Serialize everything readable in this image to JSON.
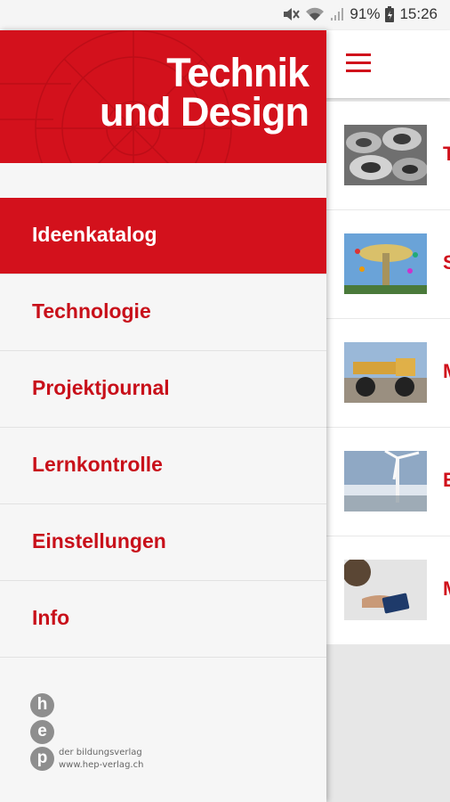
{
  "status": {
    "battery": "91%",
    "time": "15:26"
  },
  "drawer": {
    "title_line1": "Technik",
    "title_line2": "und Design",
    "items": [
      {
        "label": "Ideenkatalog",
        "active": true
      },
      {
        "label": "Technologie"
      },
      {
        "label": "Projektjournal"
      },
      {
        "label": "Lernkontrolle"
      },
      {
        "label": "Einstellungen"
      },
      {
        "label": "Info"
      }
    ],
    "logo": {
      "letters": [
        "h",
        "e",
        "p"
      ],
      "line1": "der bildungsverlag",
      "line2": "www.hep-verlag.ch"
    }
  },
  "content": {
    "menu_icon": "hamburger-menu-icon",
    "items": [
      {
        "letter": "T",
        "image": "metal-rings"
      },
      {
        "letter": "S",
        "image": "chain-swing-carousel"
      },
      {
        "letter": "M",
        "image": "mining-dump-truck"
      },
      {
        "letter": "E",
        "image": "wind-turbine"
      },
      {
        "letter": "M",
        "image": "hand-with-tablet"
      }
    ]
  },
  "colors": {
    "brand_red": "#d3111c",
    "text_red": "#c8101a"
  }
}
